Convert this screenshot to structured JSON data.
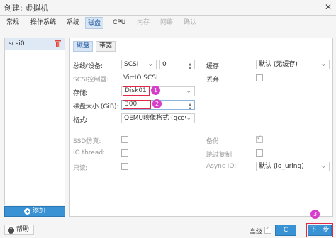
{
  "window": {
    "title": "创建: 虚拟机",
    "close_glyph": "✕"
  },
  "tabs": [
    {
      "label": "常规",
      "state": "normal"
    },
    {
      "label": "操作系统",
      "state": "normal"
    },
    {
      "label": "系统",
      "state": "normal"
    },
    {
      "label": "磁盘",
      "state": "active"
    },
    {
      "label": "CPU",
      "state": "normal"
    },
    {
      "label": "内存",
      "state": "disabled"
    },
    {
      "label": "网络",
      "state": "disabled"
    },
    {
      "label": "确认",
      "state": "disabled"
    }
  ],
  "disk_list": {
    "items": [
      {
        "label": "scsi0"
      }
    ],
    "add_label": "添加",
    "add_glyph": "+"
  },
  "subtabs": [
    {
      "label": "磁盘"
    },
    {
      "label": "带宽"
    }
  ],
  "form": {
    "bus_device": {
      "label": "总线/设备:",
      "bus": "SCSI",
      "device": "0"
    },
    "scsi_controller": {
      "label": "SCSI控制器:",
      "value": "VirtIO SCSI"
    },
    "storage": {
      "label": "存储:",
      "value": "Disk01"
    },
    "disk_size": {
      "label": "磁盘大小 (GiB):",
      "value": "300"
    },
    "format": {
      "label": "格式:",
      "value": "QEMU映像格式 (qcow"
    },
    "cache": {
      "label": "缓存:",
      "value": "默认 (无缓存)"
    },
    "discard": {
      "label": "丢弃:",
      "checked": false
    },
    "ssd": {
      "label": "SSD仿真:",
      "checked": false
    },
    "iothread": {
      "label": "IO thread:",
      "checked": false
    },
    "readonly": {
      "label": "只读:",
      "checked": false
    },
    "backup": {
      "label": "备份:",
      "checked": true
    },
    "skip_replication": {
      "label": "跳过复制:",
      "checked": false
    },
    "async_io": {
      "label": "Async IO:",
      "value": "默认 (io_uring)"
    }
  },
  "annotations": {
    "badge1": "1",
    "badge2": "2",
    "badge3": "3"
  },
  "footer": {
    "help_label": "帮助",
    "help_glyph": "?",
    "advanced_label": "高级",
    "back_label": "C",
    "next_label": "下一步"
  },
  "colors": {
    "accent": "#3892d3",
    "highlight_border": "#e0294a",
    "badge": "#d63ec9",
    "trash": "#e0433a"
  },
  "icons": {
    "trash": "trash-icon",
    "add": "plus-circle-icon",
    "help": "question-circle-icon",
    "close": "close-icon",
    "chevron": "chevron-down-icon"
  }
}
